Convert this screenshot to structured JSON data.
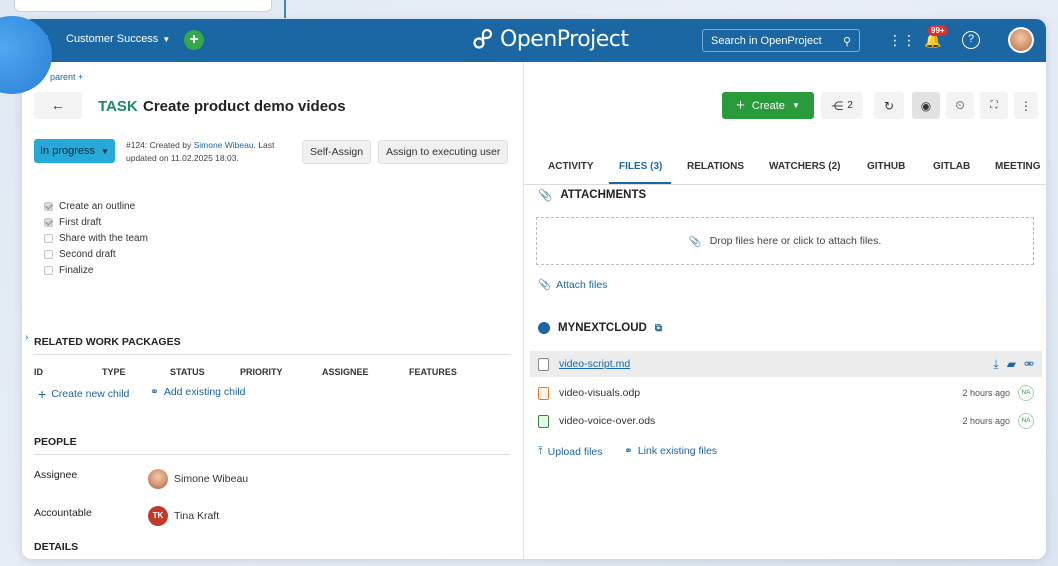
{
  "topbar": {
    "project": "Customer Success",
    "logo_text": "OpenProject",
    "search_placeholder": "Search in OpenProject",
    "notifications_badge": "99+"
  },
  "header": {
    "parent_link": "parent",
    "task_type": "TASK",
    "task_title": "Create product demo videos",
    "create_label": "Create",
    "share_count": "2"
  },
  "status": {
    "label": "In progress",
    "meta_prefix": "#124: Created by",
    "meta_author": "Simone Wibeau",
    "meta_suffix": ". Last updated on 11.02.2025 18:03.",
    "self_assign": "Self-Assign",
    "assign_exec": "Assign to executing user"
  },
  "checklist": [
    {
      "label": "Create an outline",
      "checked": true
    },
    {
      "label": "First draft",
      "checked": true
    },
    {
      "label": "Share with the team",
      "checked": false
    },
    {
      "label": "Second draft",
      "checked": false
    },
    {
      "label": "Finalize",
      "checked": false
    }
  ],
  "related": {
    "title": "RELATED WORK PACKAGES",
    "columns": [
      "ID",
      "TYPE",
      "STATUS",
      "PRIORITY",
      "ASSIGNEE",
      "FEATURES"
    ],
    "create_child": "Create new child",
    "add_child": "Add existing child"
  },
  "people": {
    "title": "PEOPLE",
    "assignee_label": "Assignee",
    "assignee_name": "Simone Wibeau",
    "accountable_label": "Accountable",
    "accountable_initials": "TK",
    "accountable_name": "Tina Kraft"
  },
  "details": {
    "title": "DETAILS"
  },
  "tabs": [
    {
      "label": "ACTIVITY",
      "active": false
    },
    {
      "label": "FILES (3)",
      "active": true
    },
    {
      "label": "RELATIONS",
      "active": false
    },
    {
      "label": "WATCHERS (2)",
      "active": false
    },
    {
      "label": "GITHUB",
      "active": false
    },
    {
      "label": "GITLAB",
      "active": false
    },
    {
      "label": "MEETING",
      "active": false
    }
  ],
  "attachments": {
    "title": "ATTACHMENTS",
    "dropzone": "Drop files here or click to attach files.",
    "attach_link": "Attach files"
  },
  "nextcloud": {
    "title": "MYNEXTCLOUD",
    "files": [
      {
        "name": "video-script.md",
        "time": "",
        "kind": "doc"
      },
      {
        "name": "video-visuals.odp",
        "time": "2 hours ago",
        "kind": "odp",
        "badge": "NA"
      },
      {
        "name": "video-voice-over.ods",
        "time": "2 hours ago",
        "kind": "ods",
        "badge": "NA"
      }
    ],
    "upload": "Upload files",
    "link_existing": "Link existing files"
  }
}
